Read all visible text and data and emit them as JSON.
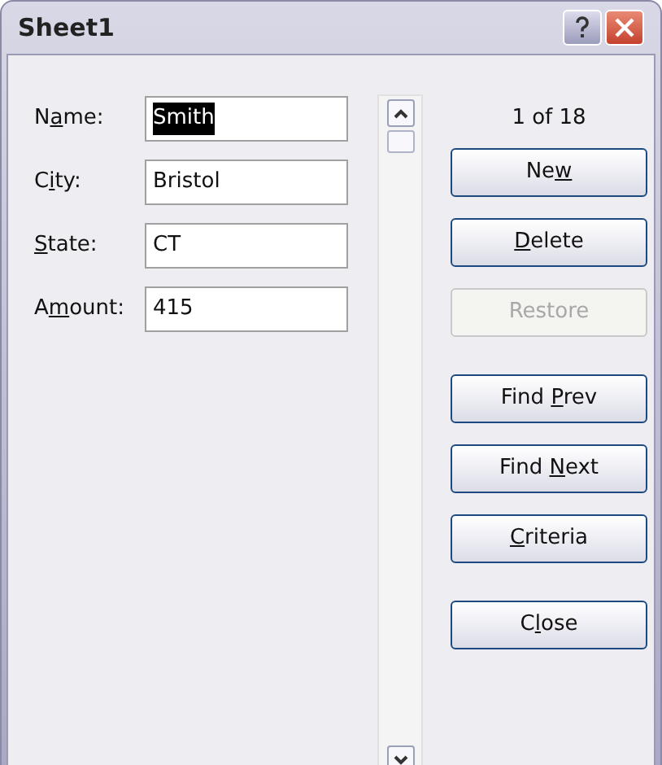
{
  "window": {
    "title": "Sheet1"
  },
  "fields": [
    {
      "label": {
        "before": "N",
        "key": "a",
        "after": "me:"
      },
      "value": "Smith",
      "selected": true
    },
    {
      "label": {
        "before": "C",
        "key": "i",
        "after": "ty:"
      },
      "value": "Bristol",
      "selected": false
    },
    {
      "label": {
        "key": "S",
        "after": "tate:"
      },
      "value": "CT",
      "selected": false
    },
    {
      "label": {
        "before": "A",
        "key": "m",
        "after": "ount:"
      },
      "value": "415",
      "selected": false
    }
  ],
  "record_counter": "1 of 18",
  "button_groups": [
    [
      {
        "before": "Ne",
        "key": "w",
        "disabled": false
      },
      {
        "key": "D",
        "after": "elete",
        "disabled": false
      },
      {
        "before": "Restore",
        "disabled": true
      }
    ],
    [
      {
        "before": "Find ",
        "key": "P",
        "after": "rev",
        "disabled": false
      },
      {
        "before": "Find ",
        "key": "N",
        "after": "ext",
        "disabled": false
      },
      {
        "key": "C",
        "after": "riteria",
        "disabled": false
      }
    ],
    [
      {
        "before": "C",
        "key": "l",
        "after": "ose",
        "disabled": false
      }
    ]
  ]
}
